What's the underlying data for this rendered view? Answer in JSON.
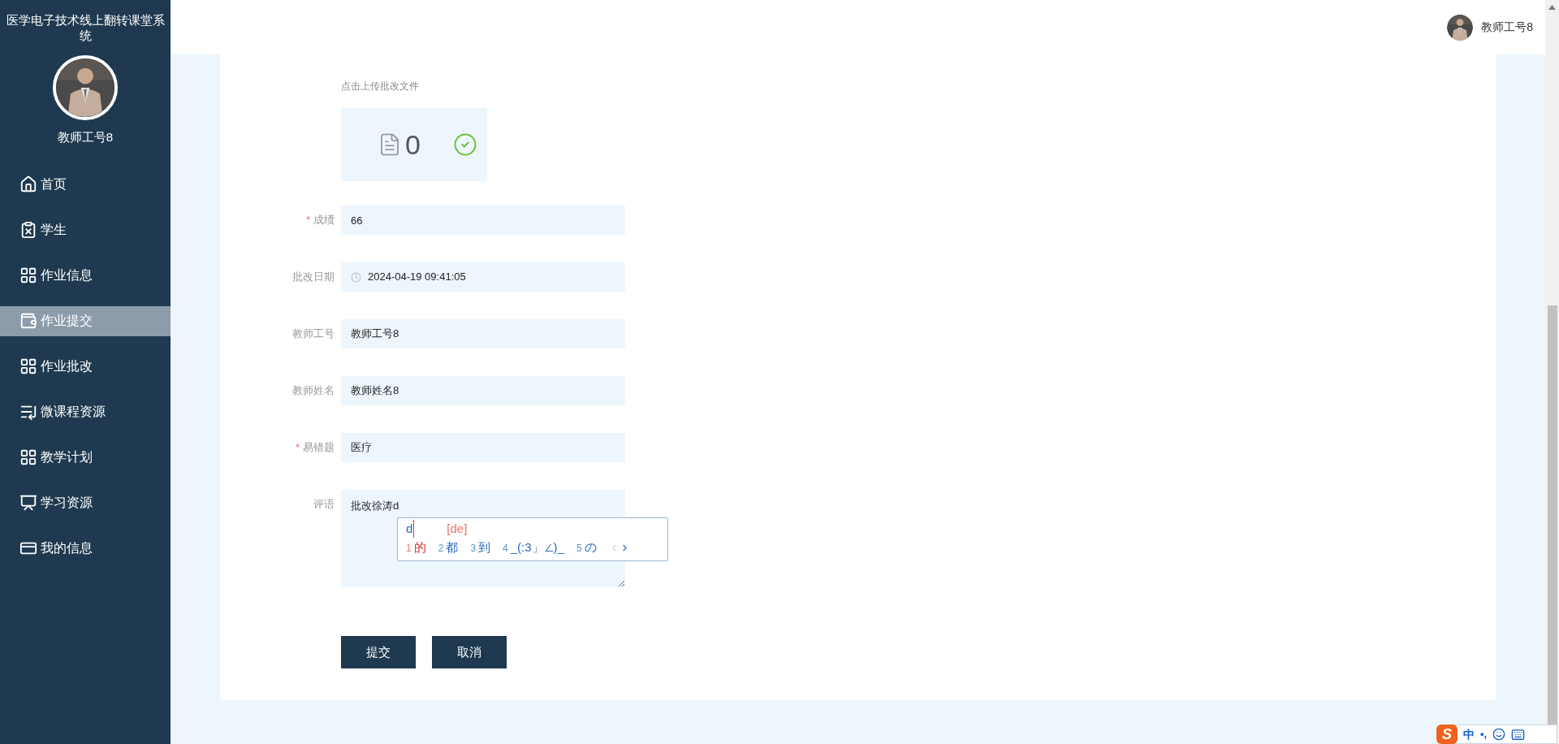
{
  "sidebar": {
    "title": "医学电子技术线上翻转课堂系统",
    "user_name": "教师工号8",
    "items": [
      {
        "label": "首页",
        "selected": false
      },
      {
        "label": "学生",
        "selected": false
      },
      {
        "label": "作业信息",
        "selected": false
      },
      {
        "label": "作业提交",
        "selected": true
      },
      {
        "label": "作业批改",
        "selected": false
      },
      {
        "label": "微课程资源",
        "selected": false
      },
      {
        "label": "教学计划",
        "selected": false
      },
      {
        "label": "学习资源",
        "selected": false
      },
      {
        "label": "我的信息",
        "selected": false
      }
    ]
  },
  "header": {
    "user_name": "教师工号8"
  },
  "upload": {
    "label": "点击上传批改文件",
    "count": "0",
    "done": true
  },
  "fields": [
    {
      "kind": "text",
      "label": "成绩",
      "required_mark": "*",
      "value": "66"
    },
    {
      "kind": "date",
      "label": "批改日期",
      "value": "2024-04-19 09:41:05"
    },
    {
      "kind": "text",
      "label": "教师工号",
      "value": "教师工号8"
    },
    {
      "kind": "text",
      "label": "教师姓名",
      "value": "教师姓名8"
    },
    {
      "kind": "text",
      "label": "易错题",
      "required_mark": "*",
      "value": "医疗"
    },
    {
      "kind": "textarea",
      "label": "评语",
      "value": "批改徐涛d"
    }
  ],
  "buttons": [
    "提交",
    "取消"
  ],
  "ime_popup": {
    "composition": "d",
    "pinyin": "[de]",
    "candidates": [
      {
        "number": "1",
        "text": "的",
        "selected": true
      },
      {
        "number": "2",
        "text": "都",
        "selected": false
      },
      {
        "number": "3",
        "text": "到",
        "selected": false
      },
      {
        "number": "4",
        "text": "_(:3」∠)_",
        "selected": false
      },
      {
        "number": "5",
        "text": "の",
        "selected": false
      }
    ]
  },
  "ime_status": {
    "logo": "S",
    "mode": "中",
    "punctuation": "•,"
  }
}
